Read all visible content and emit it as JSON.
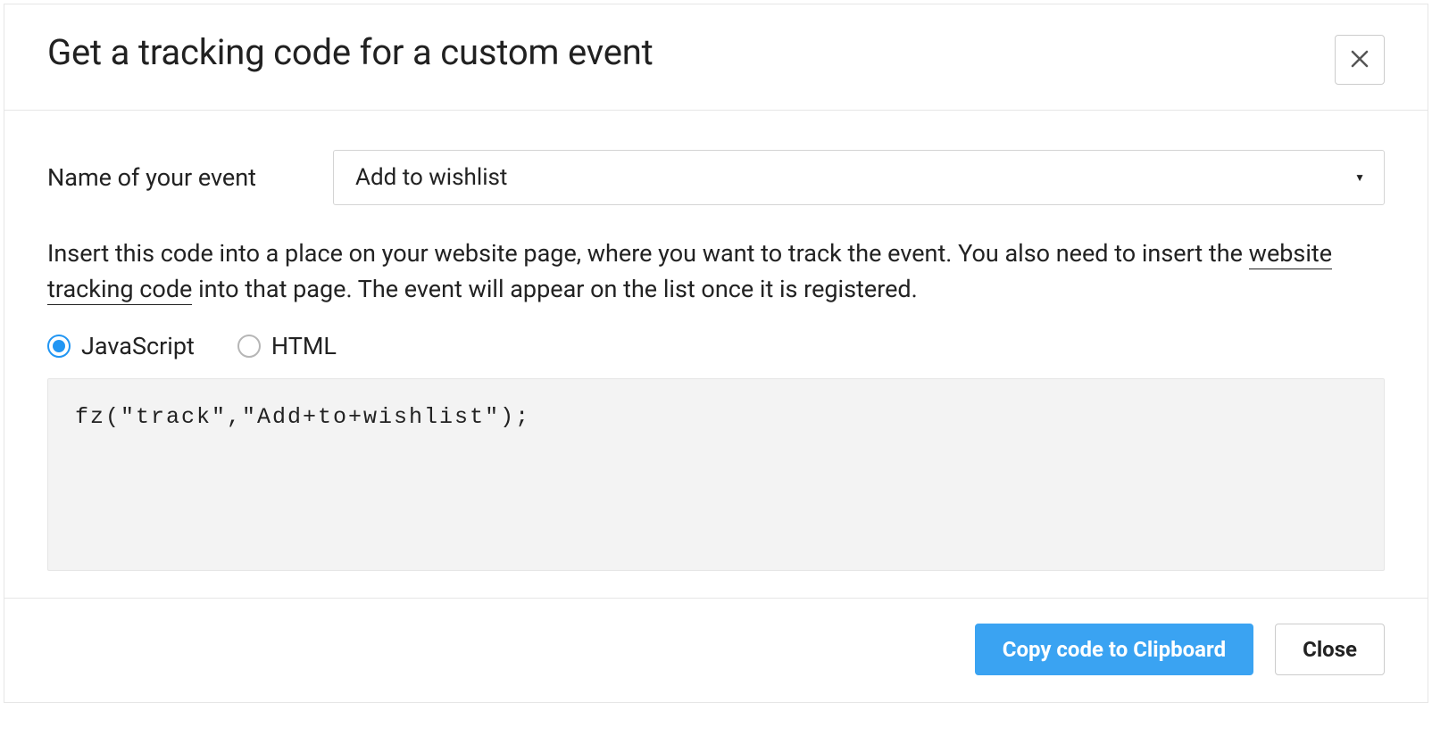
{
  "header": {
    "title": "Get a tracking code for a custom event"
  },
  "form": {
    "event_label": "Name of your event",
    "event_value": "Add to wishlist"
  },
  "instruction": {
    "part1": "Insert this code into a place on your website page, where you want to track the event. You also need to insert the ",
    "link_text": "website tracking code",
    "part2": " into that page. The event will appear on the list once it is registered."
  },
  "radios": {
    "javascript": "JavaScript",
    "html": "HTML",
    "selected": "javascript"
  },
  "code": {
    "snippet": "fz(\"track\",\"Add+to+wishlist\");"
  },
  "footer": {
    "copy_label": "Copy code to Clipboard",
    "close_label": "Close"
  }
}
